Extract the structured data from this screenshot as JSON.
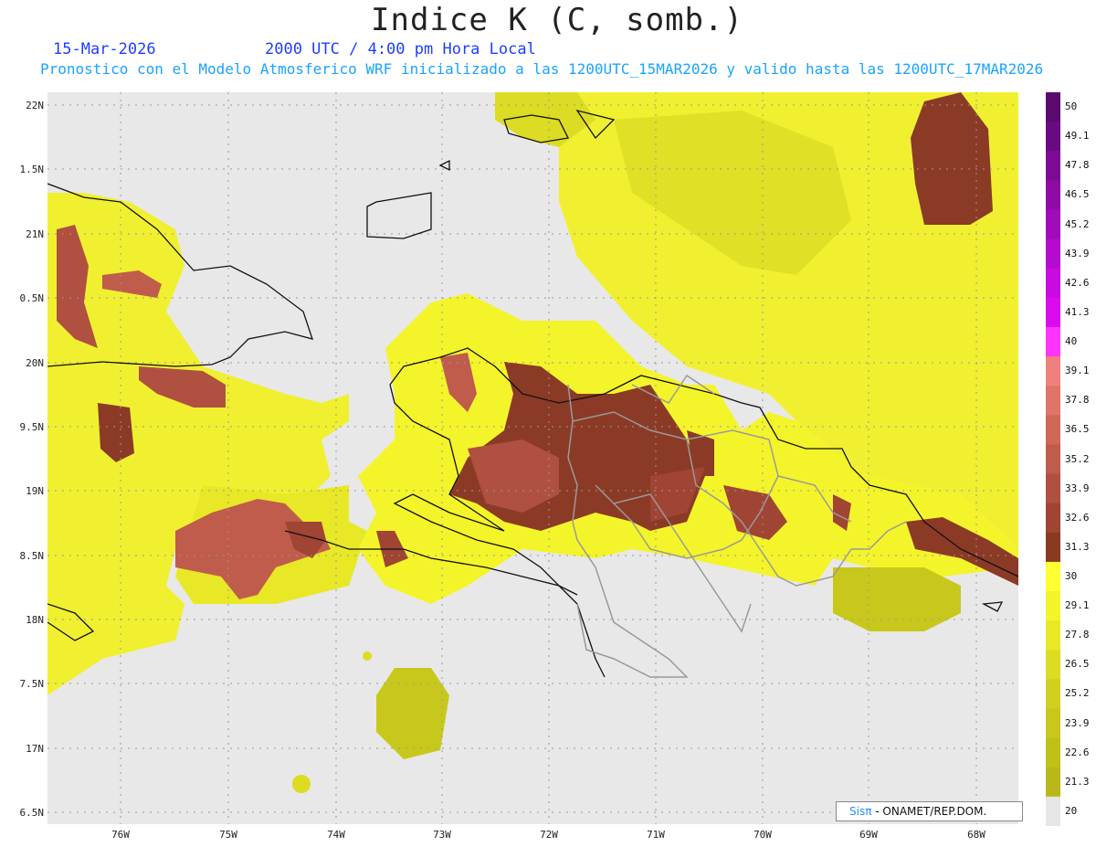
{
  "header": {
    "title": "Indice K (C, somb.)",
    "date": "15-Mar-2026",
    "time": "2000 UTC / 4:00 pm Hora Local",
    "info": "Pronostico con el Modelo Atmosferico WRF inicializado a las 1200UTC_15MAR2026 y valido hasta las  1200UTC_17MAR2026"
  },
  "axes": {
    "lat_labels": [
      "22N",
      "1.5N",
      "21N",
      "0.5N",
      "20N",
      "9.5N",
      "19N",
      "8.5N",
      "18N",
      "7.5N",
      "17N",
      "6.5N"
    ],
    "lon_labels": [
      "76W",
      "75W",
      "74W",
      "73W",
      "72W",
      "71W",
      "70W",
      "69W",
      "68W"
    ]
  },
  "colorbar": {
    "labels": [
      "50",
      "49.1",
      "47.8",
      "46.5",
      "45.2",
      "43.9",
      "42.6",
      "41.3",
      "40",
      "39.1",
      "37.8",
      "36.5",
      "35.2",
      "33.9",
      "32.6",
      "31.3",
      "30",
      "29.1",
      "27.8",
      "26.5",
      "25.2",
      "23.9",
      "22.6",
      "21.3",
      "20"
    ],
    "colors": [
      "#5a0a6e",
      "#6a0a80",
      "#7d0a94",
      "#900aa8",
      "#a30abc",
      "#b60ad0",
      "#c90ae0",
      "#dc0aee",
      "#ff33ff",
      "#f08080",
      "#e07468",
      "#d06858",
      "#c05c4c",
      "#b05040",
      "#a04434",
      "#8a3a20",
      "#ffff33",
      "#f4f42a",
      "#e8e826",
      "#dcdc22",
      "#d0d01e",
      "#c8c81c",
      "#c0c01a",
      "#b8b818",
      "#e6e6e6"
    ]
  },
  "credit": {
    "sis": "Sisπ",
    "text": " - ONAMET/REP.DOM."
  },
  "colors": {
    "land_gray": "#e8e8e8",
    "high_k": "#8b3a26",
    "mid_k": "#c85a48",
    "yellow": "#ffff33",
    "olive": "#c8c81c"
  }
}
